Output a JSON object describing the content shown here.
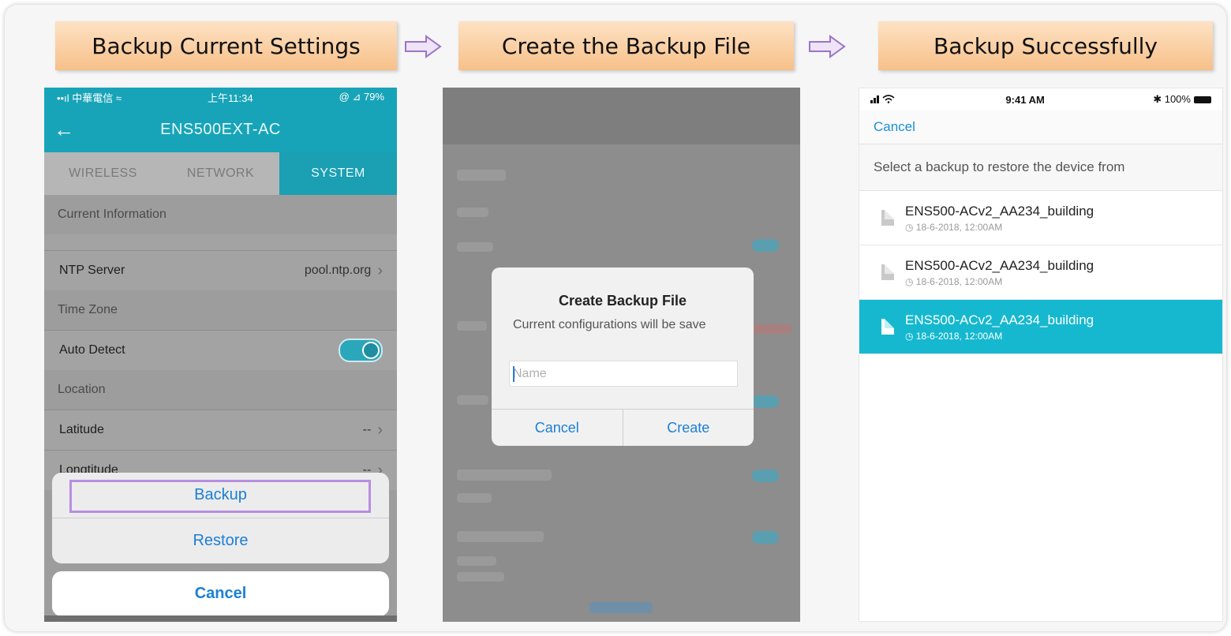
{
  "steps": [
    "Backup Current Settings",
    "Create the Backup File",
    "Backup Successfully"
  ],
  "phone1": {
    "status_left": "••ıl 中華電信 ≈",
    "status_time": "上午11:34",
    "status_right": "@ ⊿ 79%",
    "title": "ENS500EXT-AC",
    "tabs": [
      "WIRELESS",
      "NETWORK",
      "SYSTEM"
    ],
    "sections": {
      "current_info": "Current Information",
      "time_zone": "Time Zone",
      "location": "Location"
    },
    "rows": {
      "ntp_label": "NTP Server",
      "ntp_value": "pool.ntp.org",
      "auto_detect": "Auto Detect",
      "latitude": "Latitude",
      "latitude_value": "--",
      "longitude": "Longtitude",
      "longitude_value": "--"
    },
    "sheet": {
      "backup": "Backup",
      "restore": "Restore",
      "cancel": "Cancel"
    }
  },
  "phone2": {
    "dialog_title": "Create Backup File",
    "dialog_message": "Current configurations will be save",
    "name_placeholder": "Name",
    "cancel": "Cancel",
    "create": "Create"
  },
  "phone3": {
    "status_time": "9:41 AM",
    "status_right": "✱ 100%",
    "cancel": "Cancel",
    "header": "Select a backup to restore the device from",
    "files": [
      {
        "name": "ENS500-ACv2_AA234_building",
        "date": "◷ 18-6-2018, 12:00AM",
        "selected": false
      },
      {
        "name": "ENS500-ACv2_AA234_building",
        "date": "◷ 18-6-2018, 12:00AM",
        "selected": false
      },
      {
        "name": "ENS500-ACv2_AA234_building",
        "date": "◷ 18-6-2018, 12:00AM",
        "selected": true
      }
    ]
  },
  "colors": {
    "accent": "#18a4b8",
    "link": "#1b7fd6",
    "step_bg": "#f7c089",
    "highlight": "#b78ee0",
    "selected_row": "#16b8cf"
  },
  "icons": [
    "right-arrow-icon",
    "back-arrow-icon",
    "chevron-right-icon",
    "file-icon",
    "clock-icon",
    "signal-icon",
    "wifi-icon",
    "bluetooth-icon",
    "battery-icon"
  ]
}
